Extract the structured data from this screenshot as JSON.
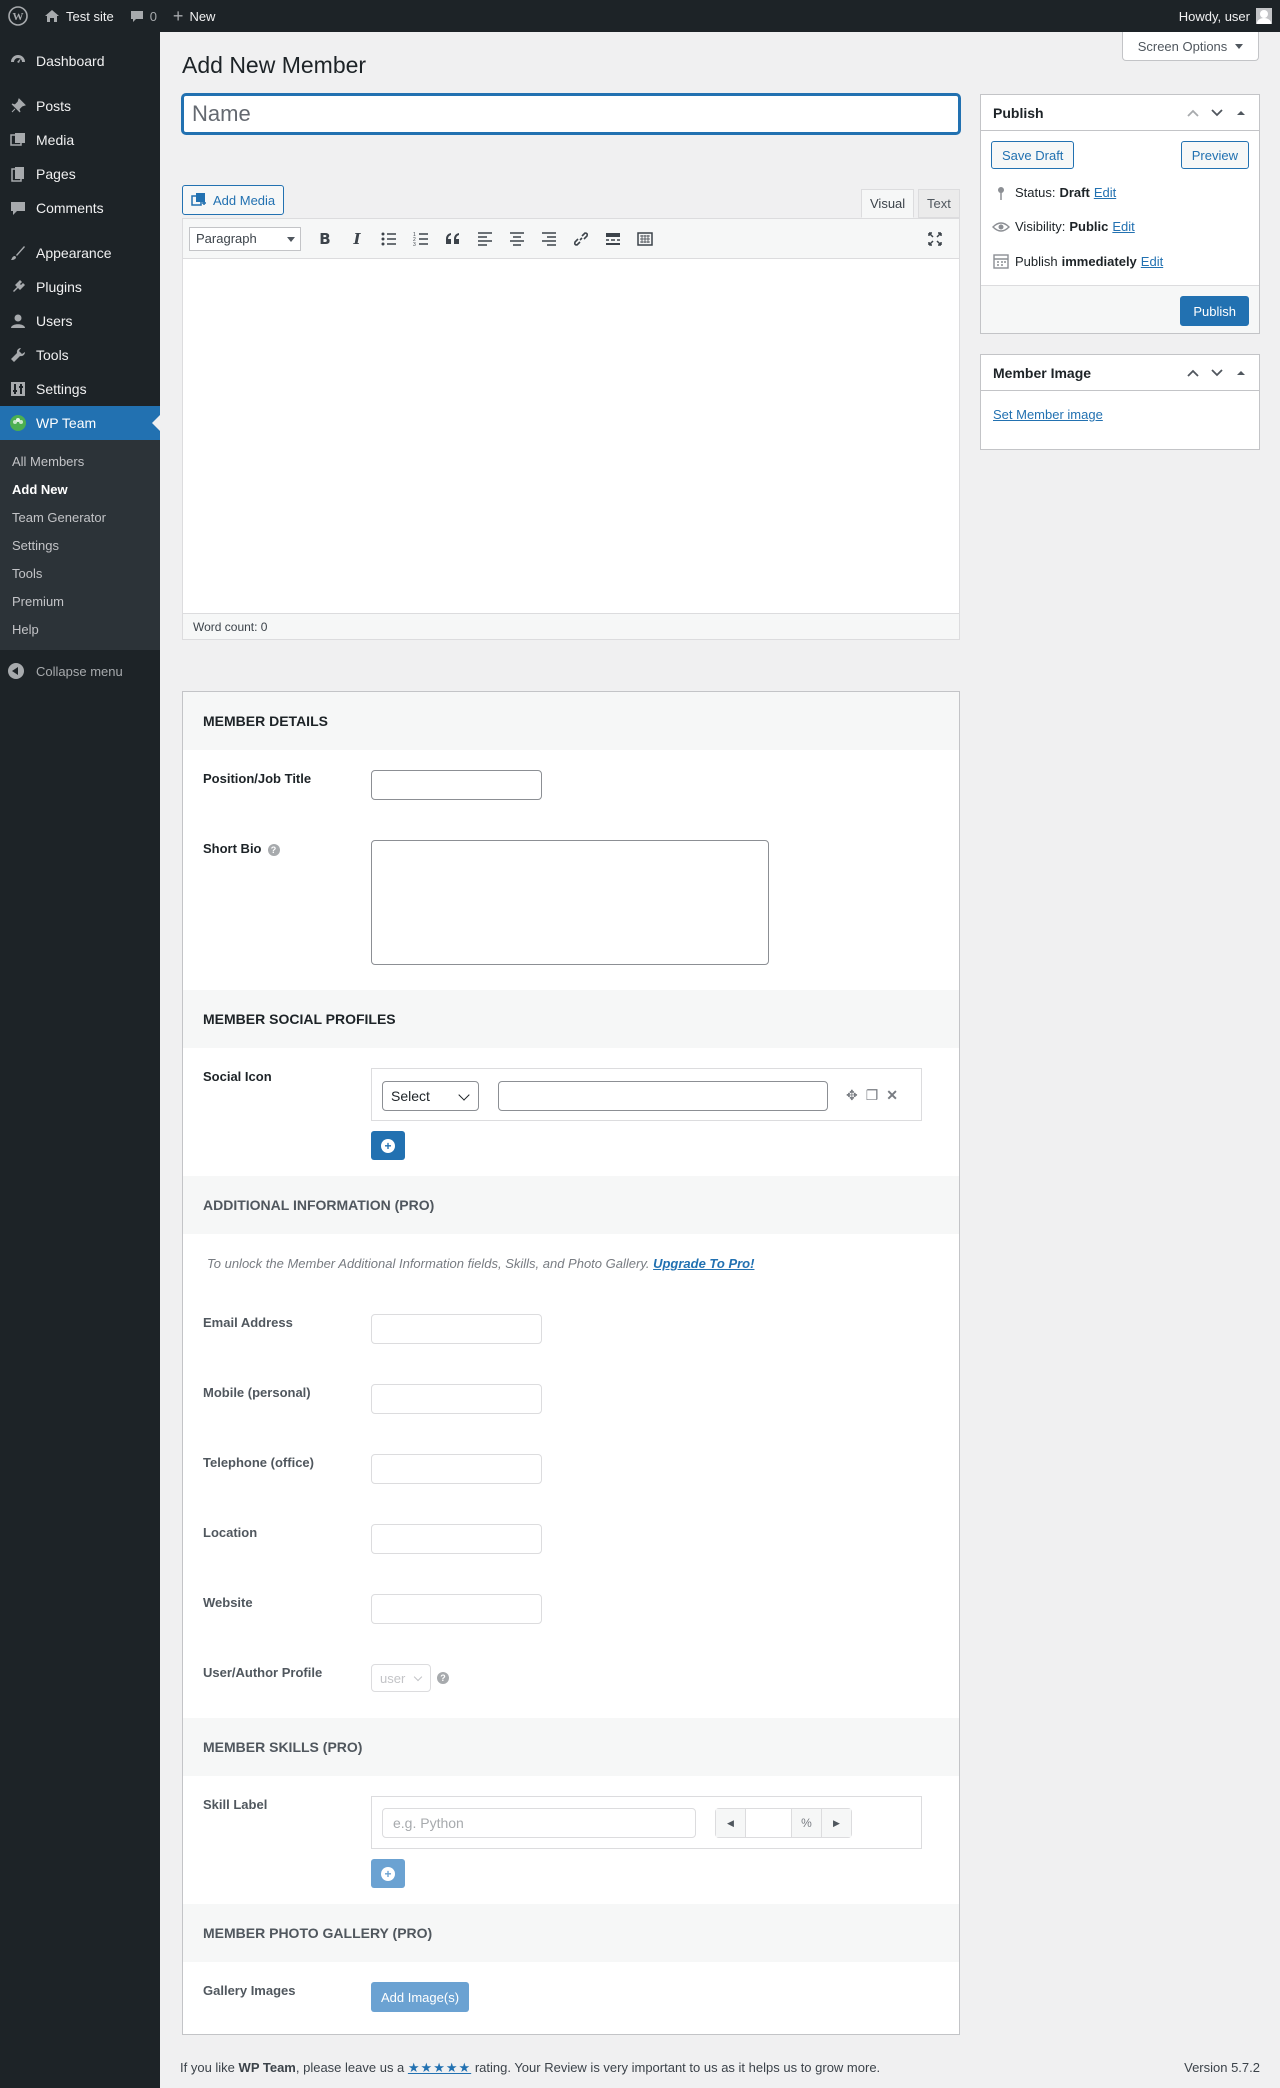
{
  "adminbar": {
    "site_name": "Test site",
    "comments_count": "0",
    "new_label": "New",
    "howdy": "Howdy, user"
  },
  "sidebar": {
    "items": [
      {
        "label": "Dashboard",
        "icon": "dashboard-icon"
      },
      {
        "label": "Posts",
        "icon": "pin-icon"
      },
      {
        "label": "Media",
        "icon": "media-icon"
      },
      {
        "label": "Pages",
        "icon": "pages-icon"
      },
      {
        "label": "Comments",
        "icon": "comment-icon"
      },
      {
        "label": "Appearance",
        "icon": "brush-icon"
      },
      {
        "label": "Plugins",
        "icon": "plug-icon"
      },
      {
        "label": "Users",
        "icon": "user-icon"
      },
      {
        "label": "Tools",
        "icon": "wrench-icon"
      },
      {
        "label": "Settings",
        "icon": "settings-icon"
      },
      {
        "label": "WP Team",
        "icon": "team-icon"
      }
    ],
    "submenu": [
      "All Members",
      "Add New",
      "Team Generator",
      "Settings",
      "Tools",
      "Premium",
      "Help"
    ],
    "collapse": "Collapse menu"
  },
  "screen_options": "Screen Options",
  "page_title": "Add New Member",
  "title_placeholder": "Name",
  "editor": {
    "add_media": "Add Media",
    "tab_visual": "Visual",
    "tab_text": "Text",
    "format": "Paragraph",
    "word_count": "Word count: 0"
  },
  "details": {
    "heading": "Member Details",
    "position_label": "Position/Job Title",
    "bio_label": "Short Bio",
    "social_heading": "Member Social Profiles",
    "social_label": "Social Icon",
    "social_select": "Select",
    "additional_heading": "Additional Information (PRO)",
    "upgrade_text": "To unlock the Member Additional Information fields, Skills, and Photo Gallery.",
    "upgrade_link": "Upgrade To Pro!",
    "email_label": "Email Address",
    "mobile_label": "Mobile (personal)",
    "telephone_label": "Telephone (office)",
    "location_label": "Location",
    "website_label": "Website",
    "user_profile_label": "User/Author Profile",
    "user_select": "user",
    "skills_heading": "Member Skills (PRO)",
    "skill_label": "Skill Label",
    "skill_placeholder": "e.g. Python",
    "percent": "%",
    "gallery_heading": "Member Photo Gallery (PRO)",
    "gallery_label": "Gallery Images",
    "gallery_button": "Add Image(s)"
  },
  "publish": {
    "title": "Publish",
    "save_draft": "Save Draft",
    "preview": "Preview",
    "status_label": "Status:",
    "status_value": "Draft",
    "visibility_label": "Visibility:",
    "visibility_value": "Public",
    "publish_label": "Publish",
    "publish_value": "immediately",
    "edit": "Edit",
    "publish_button": "Publish"
  },
  "member_image": {
    "title": "Member Image",
    "set_link": "Set Member image"
  },
  "footer": {
    "text_before": "If you like",
    "plugin": "WP Team",
    "text_middle": ", please leave us a",
    "stars": "★★★★★",
    "text_after": "rating. Your Review is very important to us as it helps us to grow more.",
    "version": "Version 5.7.2"
  },
  "colors": {
    "admin_dark": "#1d2327",
    "accent": "#2271b1",
    "background": "#f0f0f1"
  }
}
